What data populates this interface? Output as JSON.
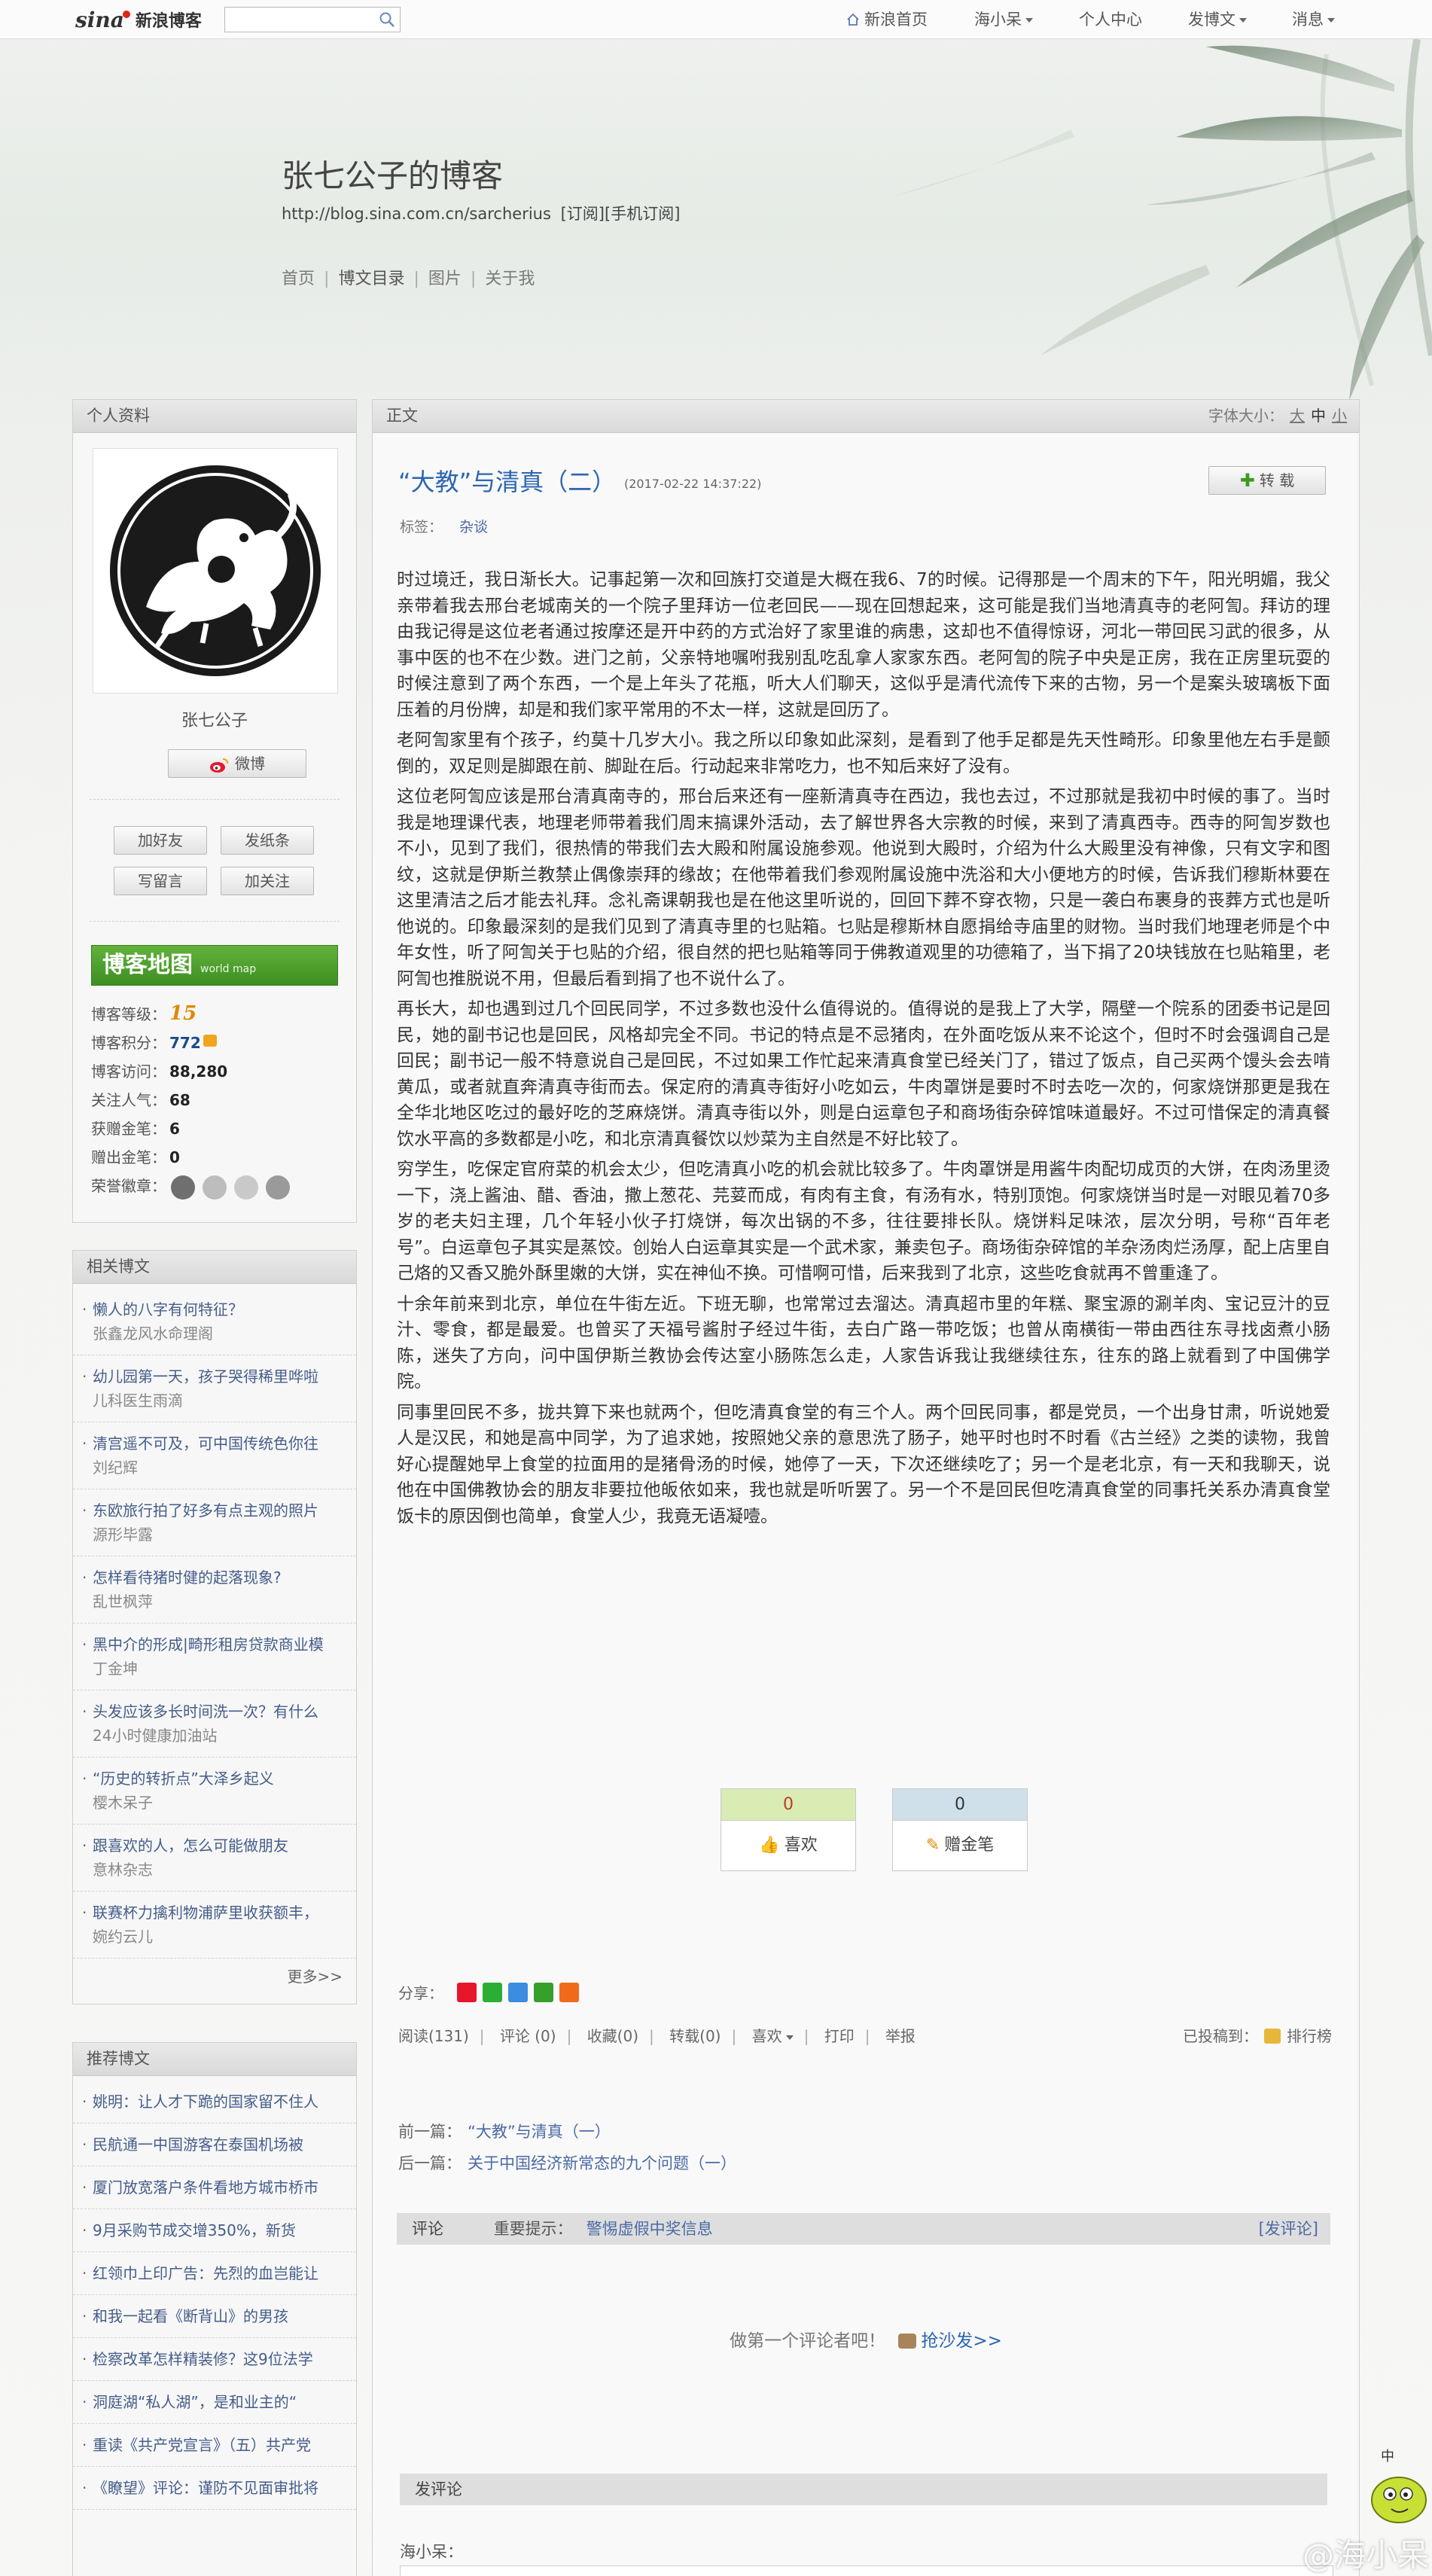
{
  "topnav": {
    "logo_sina": "sina",
    "logo_name": "新浪博客",
    "search_placeholder": "",
    "items": [
      {
        "label": "新浪首页"
      },
      {
        "label": "海小呆"
      },
      {
        "label": "个人中心"
      },
      {
        "label": "发博文"
      },
      {
        "label": "消息"
      }
    ]
  },
  "header": {
    "title": "张七公子的博客",
    "url": "http://blog.sina.com.cn/sarcherius",
    "subscribe": "[订阅]",
    "mobile_subscribe": "[手机订阅]",
    "nav": [
      "首页",
      "博文目录",
      "图片",
      "关于我"
    ]
  },
  "profile": {
    "panel_title": "个人资料",
    "name": "张七公子",
    "weibo_label": "微博",
    "buttons": [
      "加好友",
      "发纸条",
      "写留言",
      "加关注"
    ],
    "map_banner": "博客地图",
    "map_banner_sub": "world map",
    "stats": [
      {
        "label": "博客等级：",
        "value": "15"
      },
      {
        "label": "博客积分：",
        "value": "772"
      },
      {
        "label": "博客访问：",
        "value": "88,280"
      },
      {
        "label": "关注人气：",
        "value": "68"
      },
      {
        "label": "获赠金笔：",
        "value": "6"
      },
      {
        "label": "赠出金笔：",
        "value": "0"
      },
      {
        "label": "荣誉徽章：",
        "value": ""
      }
    ]
  },
  "related": {
    "panel_title": "相关博文",
    "items": [
      {
        "title": "懒人的八字有何特征？",
        "author": "张鑫龙风水命理阁"
      },
      {
        "title": "幼儿园第一天，孩子哭得稀里哗啦",
        "author": "儿科医生雨滴"
      },
      {
        "title": "清宫遥不可及，可中国传统色你往",
        "author": "刘纪辉"
      },
      {
        "title": "东欧旅行拍了好多有点主观的照片",
        "author": "源形毕露"
      },
      {
        "title": "怎样看待猪时健的起落现象?",
        "author": "乱世枫萍"
      },
      {
        "title": "黑中介的形成|畸形租房贷款商业模",
        "author": "丁金坤"
      },
      {
        "title": "头发应该多长时间洗一次？有什么",
        "author": "24小时健康加油站"
      },
      {
        "title": "“历史的转折点”大泽乡起义",
        "author": "樱木呆子"
      },
      {
        "title": "跟喜欢的人，怎么可能做朋友",
        "author": "意林杂志"
      },
      {
        "title": "联赛杯力擒利物浦萨里收获额丰，",
        "author": "婉约云儿"
      }
    ],
    "more": "更多>>"
  },
  "recommended": {
    "panel_title": "推荐博文",
    "items": [
      "姚明：让人才下跪的国家留不住人",
      "民航通一中国游客在泰国机场被",
      "厦门放宽落户条件看地方城市桥市",
      "9月采购节成交增350%，新货",
      "红领巾上印广告：先烈的血岂能让",
      "和我一起看《断背山》的男孩",
      "检察改革怎样精装修？这9位法学",
      "洞庭湖“私人湖”，是和业主的“",
      "重读《共产党宣言》（五）共产党",
      "《瞭望》评论：谨防不见面审批将"
    ]
  },
  "article": {
    "section_label": "正文",
    "font_size_label": "字体大小：",
    "font_sizes": [
      "大",
      "中",
      "小"
    ],
    "title": "“大教”与清真（二）",
    "time": "(2017-02-22 14:37:22)",
    "repost_label": "转 载",
    "tags_label": "标签：",
    "tag": "杂谈",
    "paragraphs": [
      "时过境迁，我日渐长大。记事起第一次和回族打交道是大概在我6、7的时候。记得那是一个周末的下午，阳光明媚，我父亲带着我去邢台老城南关的一个院子里拜访一位老回民——现在回想起来，这可能是我们当地清真寺的老阿訇。拜访的理由我记得是这位老者通过按摩还是开中药的方式治好了家里谁的病患，这却也不值得惊讶，河北一带回民习武的很多，从事中医的也不在少数。进门之前，父亲特地嘱咐我别乱吃乱拿人家家东西。老阿訇的院子中央是正房，我在正房里玩耍的时候注意到了两个东西，一个是上年头了花瓶，听大人们聊天，这似乎是清代流传下来的古物，另一个是案头玻璃板下面压着的月份牌，却是和我们家平常用的不太一样，这就是回历了。",
      "老阿訇家里有个孩子，约莫十几岁大小。我之所以印象如此深刻，是看到了他手足都是先天性畸形。印象里他左右手是颤倒的，双足则是脚跟在前、脚趾在后。行动起来非常吃力，也不知后来好了没有。",
      "这位老阿訇应该是邢台清真南寺的，邢台后来还有一座新清真寺在西边，我也去过，不过那就是我初中时候的事了。当时我是地理课代表，地理老师带着我们周末搞课外活动，去了解世界各大宗教的时候，来到了清真西寺。西寺的阿訇岁数也不小，见到了我们，很热情的带我们去大殿和附属设施参观。他说到大殿时，介绍为什么大殿里没有神像，只有文字和图纹，这就是伊斯兰教禁止偶像崇拜的缘故；在他带着我们参观附属设施中洗浴和大小便地方的时候，告诉我们穆斯林要在这里清洁之后才能去礼拜。念礼斋课朝我也是在他这里听说的，回回下葬不穿衣物，只是一袭白布裹身的丧葬方式也是听他说的。印象最深刻的是我们见到了清真寺里的乜贴箱。乜贴是穆斯林自愿捐给寺庙里的财物。当时我们地理老师是个中年女性，听了阿訇关于乜贴的介绍，很自然的把乜贴箱等同于佛教道观里的功德箱了，当下捐了20块钱放在乜贴箱里，老阿訇也推脱说不用，但最后看到捐了也不说什么了。",
      "再长大，却也遇到过几个回民同学，不过多数也没什么值得说的。值得说的是我上了大学，隔壁一个院系的团委书记是回民，她的副书记也是回民，风格却完全不同。书记的特点是不忌猪肉，在外面吃饭从来不论这个，但时不时会强调自己是回民；副书记一般不特意说自己是回民，不过如果工作忙起来清真食堂已经关门了，错过了饭点，自己买两个馒头会去啃黄瓜，或者就直奔清真寺街而去。保定府的清真寺街好小吃如云，牛肉罩饼是要时不时去吃一次的，何家烧饼那更是我在全华北地区吃过的最好吃的芝麻烧饼。清真寺街以外，则是白运章包子和商场街杂碎馆味道最好。不过可惜保定的清真餐饮水平高的多数都是小吃，和北京清真餐饮以炒菜为主自然是不好比较了。",
      "穷学生，吃保定官府菜的机会太少，但吃清真小吃的机会就比较多了。牛肉罩饼是用酱牛肉配切成页的大饼，在肉汤里烫一下，浇上酱油、醋、香油，撒上葱花、芫荽而成，有肉有主食，有汤有水，特别顶饱。何家烧饼当时是一对眼见着70多岁的老夫妇主理，几个年轻小伙子打烧饼，每次出锅的不多，往往要排长队。烧饼料足味浓，层次分明，号称“百年老号”。白运章包子其实是蒸饺。创始人白运章其实是一个武术家，兼卖包子。商场街杂碎馆的羊杂汤肉烂汤厚，配上店里自己烙的又香又脆外酥里嫩的大饼，实在神仙不换。可惜啊可惜，后来我到了北京，这些吃食就再不曾重逢了。",
      "十余年前来到北京，单位在牛街左近。下班无聊，也常常过去溜达。清真超市里的年糕、聚宝源的涮羊肉、宝记豆汁的豆汁、零食，都是最爱。也曾买了天福号酱肘子经过牛街，去白广路一带吃饭；也曾从南横街一带由西往东寻找卤煮小肠陈，迷失了方向，问中国伊斯兰教协会传达室小肠陈怎么走，人家告诉我让我继续往东，往东的路上就看到了中国佛学院。",
      "同事里回民不多，拢共算下来也就两个，但吃清真食堂的有三个人。两个回民同事，都是党员，一个出身甘肃，听说她爱人是汉民，和她是高中同学，为了追求她，按照她父亲的意思洗了肠子，她平时也时不时看《古兰经》之类的读物，我曾好心提醒她早上食堂的拉面用的是猪骨汤的时候，她停了一天，下次还继续吃了；另一个是老北京，有一天和我聊天，说他在中国佛教协会的朋友非要拉他皈依如来，我也就是听听罢了。另一个不是回民但吃清真食堂的同事托关系办清真食堂饭卡的原因倒也简单，食堂人少，我竟无语凝噎。"
    ],
    "like_count": "0",
    "like_label": "喜欢",
    "pen_count": "0",
    "pen_label": "赠金笔",
    "share_label": "分享：",
    "actions": {
      "read": "阅读(131)",
      "comment": "评论 (0)",
      "favorite": "收藏(0)",
      "repost": "转载(0)",
      "like": "喜欢",
      "print": "打印",
      "report": "举报",
      "submitted": "已投稿到：",
      "rank": "排行榜"
    },
    "prev_label": "前一篇：",
    "prev_title": "“大教”与清真（一）",
    "next_label": "后一篇：",
    "next_title": "关于中国经济新常态的九个问题（一）",
    "comments_label": "评论",
    "tip_label": "重要提示：",
    "tip_link": "警惕虚假中奖信息",
    "post_comment_link": "[发评论]",
    "first_comment": "做第一个评论者吧！",
    "sofa_link": "抢沙发>>",
    "post_comment_title": "发评论",
    "nickname": "海小呆："
  },
  "watermark": "@海小呆",
  "colors": {
    "link": "#4a6aa5",
    "title": "#2c66b0",
    "map_green": "#4ea22c",
    "like_green": "#d8ecb4",
    "pen_blue": "#cfe0ea"
  }
}
